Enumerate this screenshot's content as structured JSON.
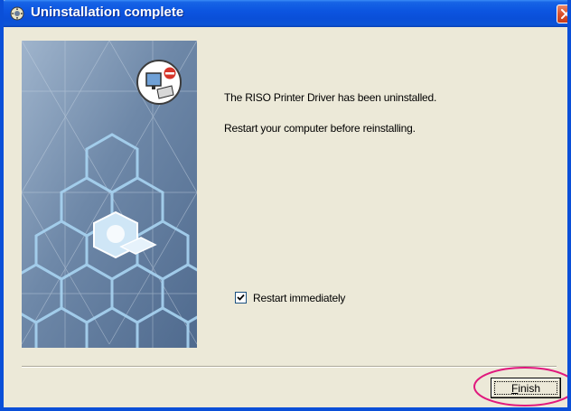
{
  "window": {
    "title": "Uninstallation complete"
  },
  "content": {
    "message_1": "The RISO Printer Driver has been uninstalled.",
    "message_2": "Restart your computer before reinstalling."
  },
  "restart_checkbox": {
    "label": "Restart immediately",
    "checked": true
  },
  "buttons": {
    "finish_mnemonic": "F",
    "finish_rest": "inish"
  },
  "colors": {
    "titlebar": "#0a4fd8",
    "close_button": "#d9502c",
    "dialog_background": "#ece9d8",
    "highlight_circle": "#e0197d"
  },
  "icons": [
    "setup-icon",
    "close-icon",
    "uninstall-computer-icon",
    "printer-icon",
    "checkmark-icon"
  ]
}
